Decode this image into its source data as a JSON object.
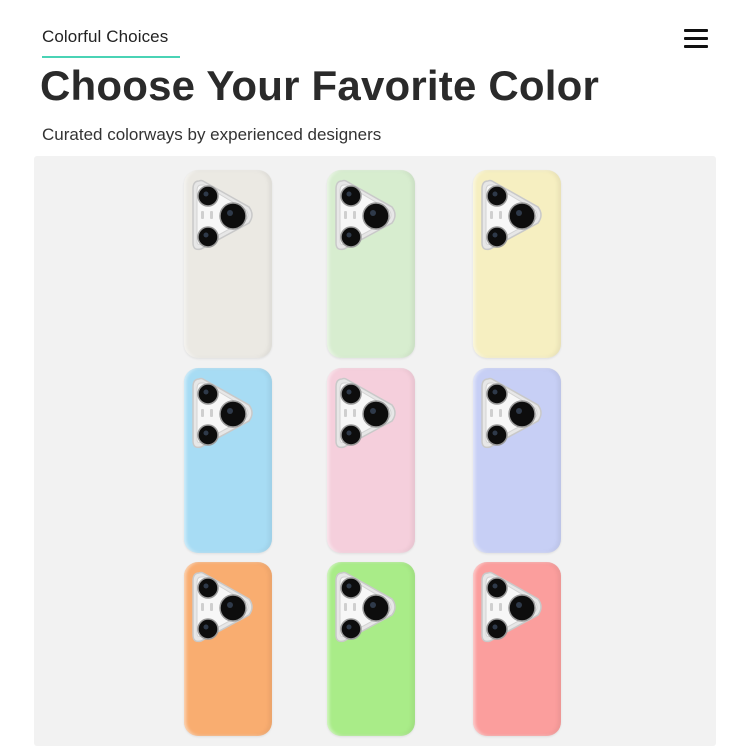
{
  "header": {
    "eyebrow": "Colorful Choices",
    "title": "Choose Your Favorite Color",
    "subtitle": "Curated colorways by experienced designers",
    "accent_color": "#4ad3b5",
    "menu_icon": "hamburger-menu-icon"
  },
  "gallery": {
    "background": "#f2f2f2",
    "colorways": [
      {
        "color": "#ebe9e3"
      },
      {
        "color": "#d7edcf"
      },
      {
        "color": "#f6efc1"
      },
      {
        "color": "#a7dcf4"
      },
      {
        "color": "#f5cfdc"
      },
      {
        "color": "#c7cff5"
      },
      {
        "color": "#f9ad70"
      },
      {
        "color": "#a9ec88"
      },
      {
        "color": "#fb9e9d"
      }
    ]
  }
}
